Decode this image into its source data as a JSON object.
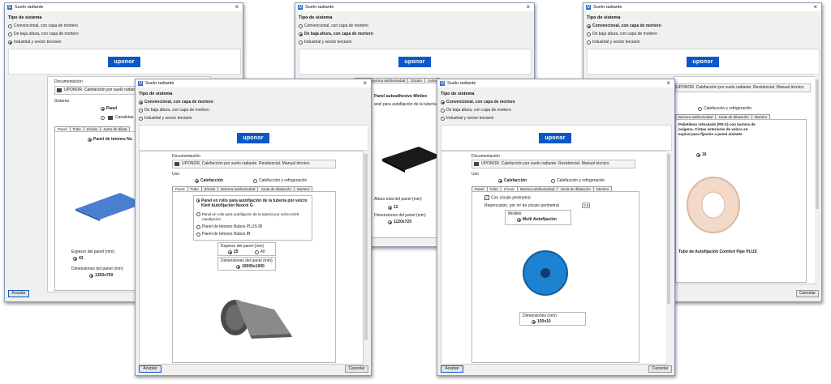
{
  "dialog_title": "Suelo radiante",
  "tipo_title": "Tipo de sistema",
  "opts": [
    "Convencional, con capa de mortero",
    "De baja altura, con capa de mortero",
    "Industrial y sector terciario"
  ],
  "logo": "uponor",
  "aceptar": "Aceptar",
  "cancelar": "Cancelar",
  "documentacion": "Documentación",
  "doc_text": "UPONOR. Calefacción por suelo radiante. Residencial. Manual técnico.",
  "doc_text_short": "UPONOR. Calefacción por suelo radiante",
  "uso": "Uso",
  "calefaccion": "Calefacción",
  "calef_refrig": "Calefacción y refrigeración",
  "tabs_main": [
    "Panel",
    "Tubo",
    "Zócalo",
    "Barrera antihumedad",
    "Junta de dilatación",
    "Mortero"
  ],
  "tabs_w1": [
    "Panel",
    "Tubo",
    "Zócalo",
    "Junta de dilata"
  ],
  "tabs_w2": [
    "Tubo",
    "Barrera antihumedad",
    "Zócalo",
    "Junta"
  ],
  "tabs_w3": [
    "Barrera antihumedad",
    "Junta de dilatación",
    "Mortero"
  ],
  "w1": {
    "sistema": "Sistema",
    "panel": "Panel",
    "canaletas": "Canaletas",
    "selected_panel": "Panel de tetones Nu",
    "espesor": "Espesor del panel (mm)",
    "espesor_val": "43",
    "dims": "Dimensiones del panel (mm)",
    "dims_val": "1350x750"
  },
  "w2": {
    "selected": "Panel autoadhesivo Minitec",
    "desc": "anel para autofijación de la tubería por velcro",
    "altura": "Altura total del panel (mm)",
    "altura_val": "12",
    "dims": "Dimensiones del panel (mm)",
    "dims_val": "1120x720"
  },
  "w3": {
    "selected": "Polietileno reticulado (PE-X) con barrera de oxígeno. Cintas exteriores de velcro en espiral para fijación a panel aislante",
    "diam_val": "16",
    "tube_name": "Tubo de Autofijación Comfort Pipe PLUS"
  },
  "w4": {
    "panel_options": [
      "Panel en rollo para autofijación de la tubería por velcro Klett Autofijación Neorol G",
      "Panel en rollo para autofijación de la tubería por velcro Klett Autofijación",
      "Panel de tetones Nubos PLUS IB",
      "Panel de tetones Nubos IB"
    ],
    "espesor": "Espesor del panel (mm)",
    "espesor_opts": [
      "25",
      "40"
    ],
    "dims": "Dimensiones del panel (mm)",
    "dims_val": "10000x1000"
  },
  "w5": {
    "con_zocalo": "Con zócalo perimetral",
    "repercusion": "Repercusión, por m² de zócalo perimetral",
    "repercusion_val": "0.5",
    "modelo": "Modelo",
    "modelo_val": "Multi Autofijación",
    "dims": "Dimensiones (mm)",
    "dims_val": "150x10"
  }
}
